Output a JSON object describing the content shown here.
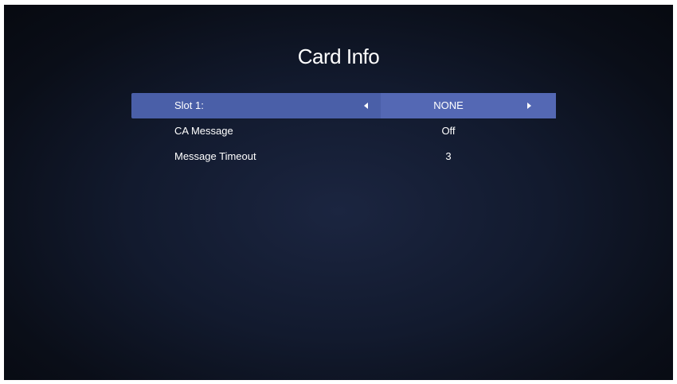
{
  "title": "Card Info",
  "menu": {
    "items": [
      {
        "label": "Slot 1:",
        "value": "NONE",
        "selected": true
      },
      {
        "label": "CA Message",
        "value": "Off",
        "selected": false
      },
      {
        "label": "Message Timeout",
        "value": "3",
        "selected": false
      }
    ]
  },
  "colors": {
    "highlight": "#4a5fa8",
    "background": "#121a2e"
  }
}
